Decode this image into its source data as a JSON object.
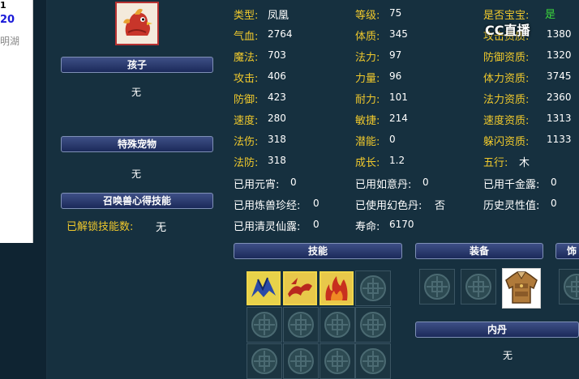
{
  "side_strip": {
    "line1": "1",
    "line2": "20",
    "line3": "明湖"
  },
  "watermark": "CC直播",
  "left_column": {
    "child_header": "孩子",
    "child_value": "无",
    "special_pet_header": "特殊宠物",
    "special_pet_value": "无",
    "skill_book_header": "召唤兽心得技能",
    "unlocked_label": "已解锁技能数:",
    "unlocked_value": "无"
  },
  "stats_col1": [
    {
      "label": "类型:",
      "value": "凤凰"
    },
    {
      "label": "气血:",
      "value": "2764"
    },
    {
      "label": "魔法:",
      "value": "703"
    },
    {
      "label": "攻击:",
      "value": "406"
    },
    {
      "label": "防御:",
      "value": "423"
    },
    {
      "label": "速度:",
      "value": "280"
    },
    {
      "label": "法伤:",
      "value": "318"
    },
    {
      "label": "法防:",
      "value": "318"
    }
  ],
  "stats_col2": [
    {
      "label": "等级:",
      "value": "75"
    },
    {
      "label": "体质:",
      "value": "345"
    },
    {
      "label": "法力:",
      "value": "97"
    },
    {
      "label": "力量:",
      "value": "96"
    },
    {
      "label": "耐力:",
      "value": "101"
    },
    {
      "label": "敏捷:",
      "value": "214"
    },
    {
      "label": "潜能:",
      "value": "0"
    },
    {
      "label": "成长:",
      "value": "1.2"
    }
  ],
  "stats_col3": [
    {
      "label": "是否宝宝:",
      "value": "是"
    },
    {
      "label": "攻击资质:",
      "value": "1380"
    },
    {
      "label": "防御资质:",
      "value": "1320"
    },
    {
      "label": "体力资质:",
      "value": "3745"
    },
    {
      "label": "法力资质:",
      "value": "2360"
    },
    {
      "label": "速度资质:",
      "value": "1313"
    },
    {
      "label": "躲闪资质:",
      "value": "1133"
    },
    {
      "label": "五行:",
      "value": "木"
    }
  ],
  "extra_rows": [
    {
      "a_label": "已用元宵:",
      "a_value": "0",
      "b_label": "已用如意丹:",
      "b_value": "0",
      "c_label": "已用千金露:",
      "c_value": "0"
    },
    {
      "a_label": "已用炼兽珍经:",
      "a_value": "0",
      "b_label": "已使用幻色丹:",
      "b_value": "否",
      "c_label": "历史灵性值:",
      "c_value": "0"
    },
    {
      "a_label": "已用清灵仙露:",
      "a_value": "0",
      "b_label": "寿命:",
      "b_value": "6170"
    }
  ],
  "sections": {
    "skills_header": "技能",
    "equipment_header": "装备",
    "ornament_header": "饰",
    "neidan_header": "内丹",
    "neidan_value": "无"
  },
  "colors": {
    "label_yellow": "#f0c92c",
    "value_white": "#ffffff",
    "baby_green": "#3cd83c",
    "header_blue": "#2c3c70"
  },
  "icons": [
    "phoenix-portrait-icon",
    "blue-bird-skill-icon",
    "red-bird-skill-icon",
    "fire-skill-icon",
    "empty-slot-icon",
    "armor-icon"
  ]
}
